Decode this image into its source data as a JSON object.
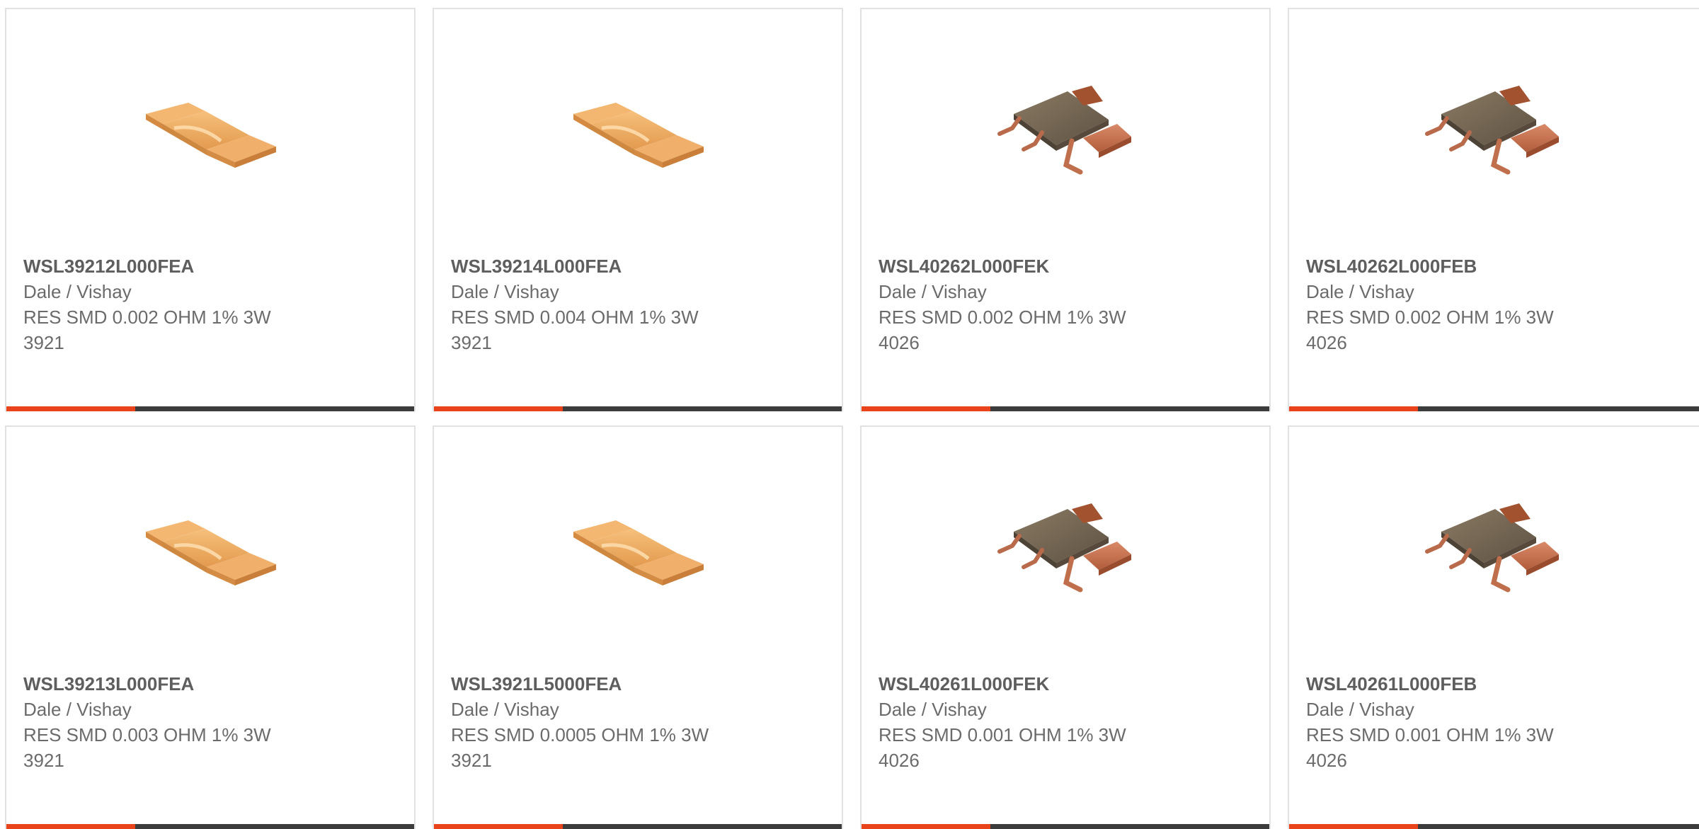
{
  "colors": {
    "accent": "#e8431a",
    "bar": "#3c3c3c",
    "border": "#e2e2e2",
    "text": "#6b6b6b"
  },
  "products": [
    {
      "part_number": "WSL39212L000FEA",
      "manufacturer": "Dale / Vishay",
      "description": "RES SMD 0.002 OHM 1% 3W",
      "package": "3921",
      "image": "copper-shunt-resistor-image"
    },
    {
      "part_number": "WSL39214L000FEA",
      "manufacturer": "Dale / Vishay",
      "description": "RES SMD 0.004 OHM 1% 3W",
      "package": "3921",
      "image": "copper-shunt-resistor-image"
    },
    {
      "part_number": "WSL40262L000FEK",
      "manufacturer": "Dale / Vishay",
      "description": "RES SMD 0.002 OHM 1% 3W",
      "package": "4026",
      "image": "metal-strip-resistor-image"
    },
    {
      "part_number": "WSL40262L000FEB",
      "manufacturer": "Dale / Vishay",
      "description": "RES SMD 0.002 OHM 1% 3W",
      "package": "4026",
      "image": "metal-strip-resistor-image"
    },
    {
      "part_number": "WSL39213L000FEA",
      "manufacturer": "Dale / Vishay",
      "description": "RES SMD 0.003 OHM 1% 3W",
      "package": "3921",
      "image": "copper-shunt-resistor-image"
    },
    {
      "part_number": "WSL3921L5000FEA",
      "manufacturer": "Dale / Vishay",
      "description": "RES SMD 0.0005 OHM 1% 3W",
      "package": "3921",
      "image": "copper-shunt-resistor-image"
    },
    {
      "part_number": "WSL40261L000FEK",
      "manufacturer": "Dale / Vishay",
      "description": "RES SMD 0.001 OHM 1% 3W",
      "package": "4026",
      "image": "metal-strip-resistor-image"
    },
    {
      "part_number": "WSL40261L000FEB",
      "manufacturer": "Dale / Vishay",
      "description": "RES SMD 0.001 OHM 1% 3W",
      "package": "4026",
      "image": "metal-strip-resistor-image"
    }
  ]
}
